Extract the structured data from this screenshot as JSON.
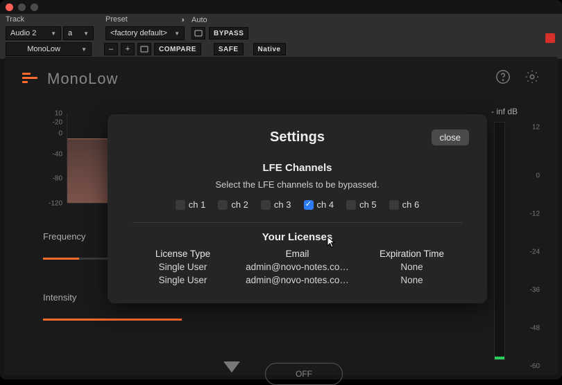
{
  "host": {
    "track_label": "Track",
    "preset_label": "Preset",
    "auto_label": "Auto",
    "track_value": "Audio 2",
    "track_suffix": "a",
    "preset_value": "<factory default>",
    "plugin_value": "MonoLow",
    "bypass": "BYPASS",
    "compare": "COMPARE",
    "safe": "SAFE",
    "native": "Native"
  },
  "plugin": {
    "brand": "MonoLow",
    "graph_ticks": [
      "10",
      "-20",
      "0",
      "-40",
      "-80",
      "-120"
    ],
    "frequency_label": "Frequency",
    "intensity_label": "Intensity",
    "off_label": "OFF",
    "meter_label": "- inf dB",
    "meter_ticks": [
      "12",
      "0",
      "-12",
      "-24",
      "-36",
      "-48",
      "-60"
    ]
  },
  "modal": {
    "title": "Settings",
    "close": "close",
    "lfe_title": "LFE Channels",
    "lfe_desc": "Select the LFE channels to be bypassed.",
    "channels": [
      {
        "label": "ch 1",
        "checked": false
      },
      {
        "label": "ch 2",
        "checked": false
      },
      {
        "label": "ch 3",
        "checked": false
      },
      {
        "label": "ch 4",
        "checked": true
      },
      {
        "label": "ch 5",
        "checked": false
      },
      {
        "label": "ch 6",
        "checked": false
      }
    ],
    "lic_title": "Your Licenses",
    "lic_headers": {
      "type": "License Type",
      "email": "Email",
      "exp": "Expiration Time"
    },
    "lic_rows": [
      {
        "type": "Single User",
        "email": "admin@novo-notes.co…",
        "exp": "None"
      },
      {
        "type": "Single User",
        "email": "admin@novo-notes.co…",
        "exp": "None"
      }
    ]
  }
}
